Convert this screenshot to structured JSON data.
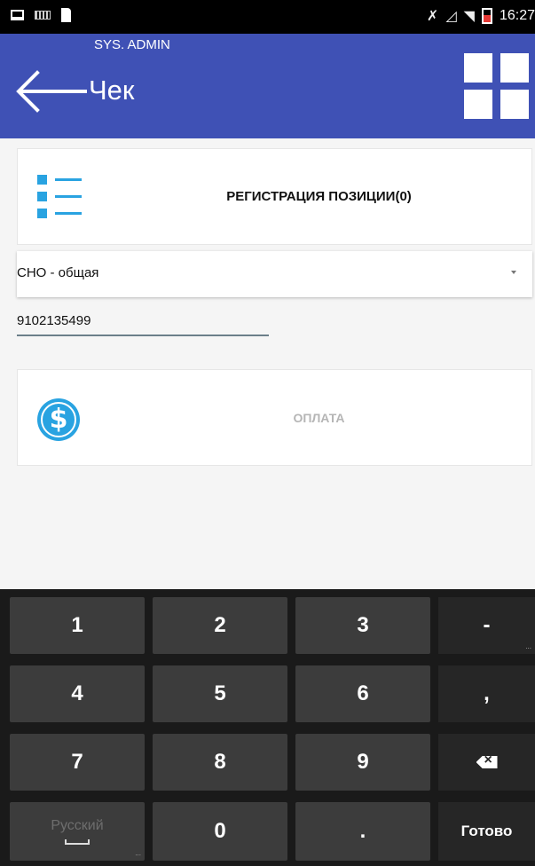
{
  "status_bar": {
    "time": "16:27",
    "icons": [
      "screenshot-icon",
      "keyboard-icon",
      "sim-icon",
      "mute-icon",
      "no-signal-icon",
      "wifi-icon",
      "battery-icon"
    ]
  },
  "app_bar": {
    "user": "SYS. ADMIN",
    "title": "Чек",
    "color": "#3f51b5"
  },
  "content": {
    "register_label": "РЕГИСТРАЦИЯ ПОЗИЦИИ(0)",
    "tax_system": "СНО - общая",
    "phone_value": "9102135499",
    "payment_label": "ОПЛАТА",
    "accent_color": "#29a3e1"
  },
  "keyboard": {
    "k1": "1",
    "k2": "2",
    "k3": "3",
    "minus": "-",
    "k4": "4",
    "k5": "5",
    "k6": "6",
    "comma": ",",
    "k7": "7",
    "k8": "8",
    "k9": "9",
    "language": "Русский",
    "k0": "0",
    "dot": ".",
    "done": "Готово",
    "more": "..."
  }
}
